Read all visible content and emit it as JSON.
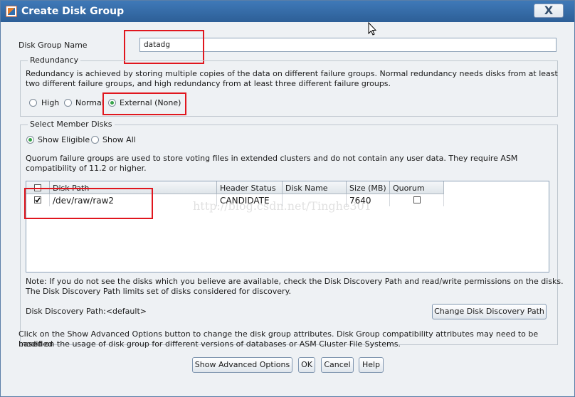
{
  "window": {
    "title": "Create Disk Group",
    "close_symbol": "X",
    "app_icon": "oracle-app-icon",
    "cursor_icon": "mouse-pointer-icon"
  },
  "name_field": {
    "label": "Disk Group Name",
    "value": "datadg"
  },
  "redundancy": {
    "title": "Redundancy",
    "description_1": "Redundancy is achieved by storing multiple copies of the data on different failure groups. Normal redundancy needs disks from at least",
    "description_2": "two different failure groups, and high redundancy from at least three different failure groups.",
    "options": [
      {
        "label": "High",
        "selected": false
      },
      {
        "label": "Normal",
        "selected": false
      },
      {
        "label": "External (None)",
        "selected": true
      }
    ]
  },
  "members": {
    "title": "Select Member Disks",
    "options": [
      {
        "label": "Show Eligible",
        "selected": true
      },
      {
        "label": "Show All",
        "selected": false
      }
    ],
    "quorum_text_1": "Quorum failure groups are used to store voting files in extended clusters and do not contain any user data. They require ASM",
    "quorum_text_2": "compatibility of 11.2 or higher.",
    "table": {
      "columns": [
        "",
        "Disk Path",
        "Header Status",
        "Disk Name",
        "Size (MB)",
        "Quorum"
      ],
      "rows": [
        {
          "selected": true,
          "path": "/dev/raw/raw2",
          "status": "CANDIDATE",
          "name": "",
          "size": "7640",
          "quorum": false
        }
      ]
    },
    "note_1": "Note: If you do not see the disks which you believe are available, check the Disk Discovery Path and read/write permissions on the disks.",
    "note_2": "The Disk Discovery Path limits set of disks considered for discovery.",
    "discovery_label": "Disk Discovery Path:<default>",
    "change_button": "Change Disk Discovery Path"
  },
  "footer": {
    "text_1": "Click on the Show Advanced Options button to change the disk group attributes. Disk Group compatibility attributes may need to be modified",
    "text_2": "based on the usage of disk group for different versions of databases or ASM Cluster File Systems.",
    "buttons": {
      "advanced": "Show Advanced Options",
      "ok": "OK",
      "cancel": "Cancel",
      "help": "Help"
    }
  },
  "watermark": "http://blog.csdn.net/Tinghe301",
  "colors": {
    "title_bar": "#2f67a3",
    "annotation_red": "#e0161e",
    "radio_selected": "#37a34a"
  }
}
